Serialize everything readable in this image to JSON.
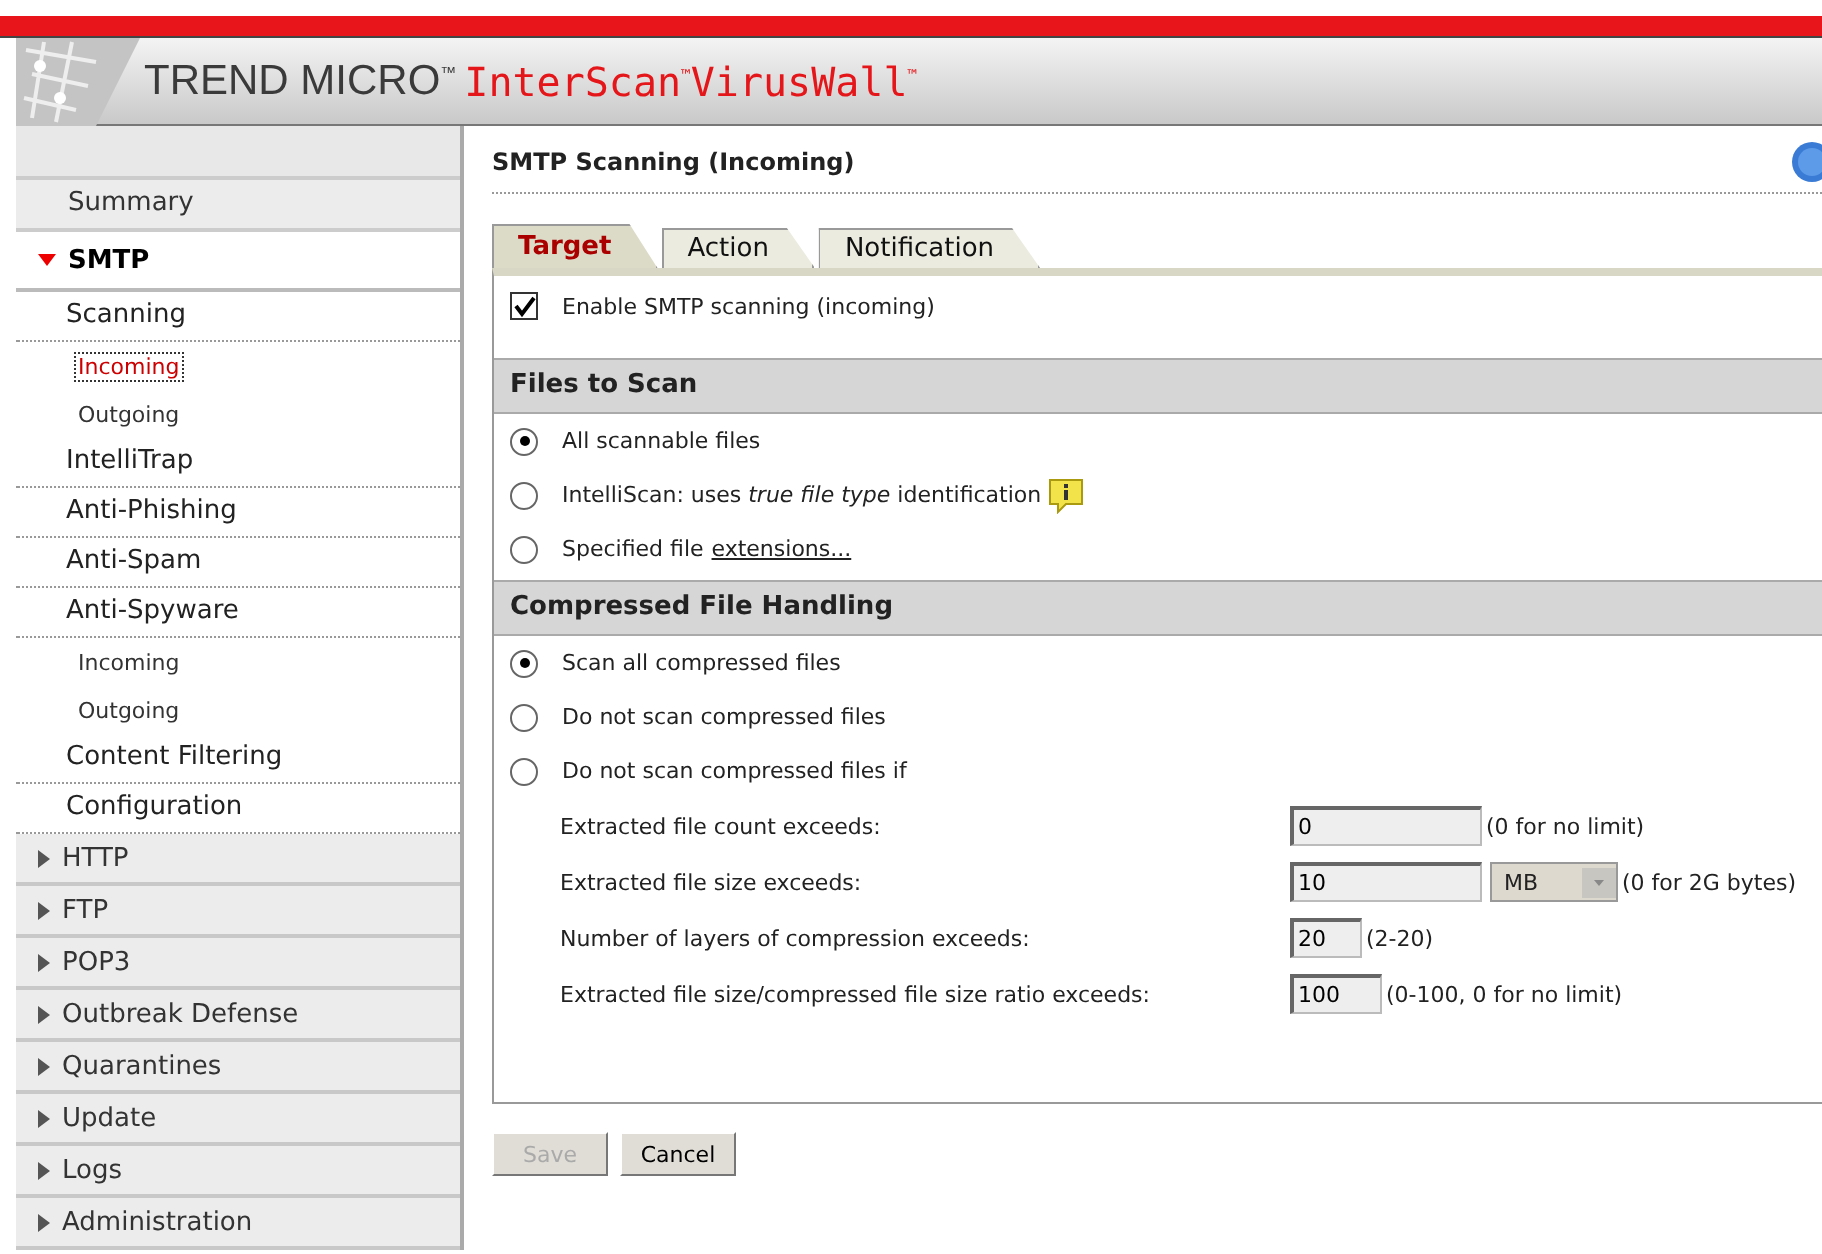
{
  "header": {
    "vendor": "TREND MICRO$^{™}$",
    "product": "InterScan$^{™}$VirusWall$^{™}$"
  },
  "sidebar": {
    "items": [
      {
        "label": "Summary",
        "kind": "top",
        "selected": false
      },
      {
        "label": "SMTP",
        "kind": "group",
        "expanded": true,
        "selected": false,
        "children": [
          {
            "label": "Scanning",
            "selected": false,
            "children": [
              {
                "label": "Incoming",
                "selected": true
              },
              {
                "label": "Outgoing",
                "selected": false
              }
            ]
          },
          {
            "label": "IntelliTrap",
            "selected": false
          },
          {
            "label": "Anti-Phishing",
            "selected": false
          },
          {
            "label": "Anti-Spam",
            "selected": false
          },
          {
            "label": "Anti-Spyware",
            "selected": false,
            "children": [
              {
                "label": "Incoming",
                "selected": false
              },
              {
                "label": "Outgoing",
                "selected": false
              }
            ]
          },
          {
            "label": "Content Filtering",
            "selected": false
          },
          {
            "label": "Configuration",
            "selected": false
          }
        ]
      },
      {
        "label": "HTTP",
        "kind": "group",
        "expanded": false,
        "selected": false
      },
      {
        "label": "FTP",
        "kind": "group",
        "expanded": false,
        "selected": false
      },
      {
        "label": "POP3",
        "kind": "group",
        "expanded": false,
        "selected": false
      },
      {
        "label": "Outbreak Defense",
        "kind": "group",
        "expanded": false,
        "selected": false
      },
      {
        "label": "Quarantines",
        "kind": "group",
        "expanded": false,
        "selected": false
      },
      {
        "label": "Update",
        "kind": "group",
        "expanded": false,
        "selected": false
      },
      {
        "label": "Logs",
        "kind": "group",
        "expanded": false,
        "selected": false
      },
      {
        "label": "Administration",
        "kind": "group",
        "expanded": false,
        "selected": false
      }
    ]
  },
  "page": {
    "title": "SMTP Scanning (Incoming)",
    "tabs": [
      {
        "label": "Target",
        "selected": true
      },
      {
        "label": "Action",
        "selected": false
      },
      {
        "label": "Notification",
        "selected": false
      }
    ],
    "enable": {
      "label": "Enable SMTP scanning (incoming)",
      "checked": true
    },
    "files_to_scan": {
      "heading": "Files to Scan",
      "options": [
        {
          "label": "All scannable files",
          "selected": true
        },
        {
          "label": "IntelliScan: uses *true file type* identification",
          "selected": false,
          "info": true
        },
        {
          "label": "Specified file ",
          "link": "extensions...",
          "selected": false
        }
      ]
    },
    "compressed": {
      "heading": "Compressed File Handling",
      "options": [
        {
          "label": "Scan all compressed files",
          "selected": true
        },
        {
          "label": "Do not scan compressed files",
          "selected": false
        },
        {
          "label": "Do not scan compressed files if",
          "selected": false
        }
      ],
      "limits": [
        {
          "label": "Extracted file count exceeds:",
          "value": "0",
          "hint": "(0 for no limit)",
          "disabled": true
        },
        {
          "label": "Extracted file size exceeds:",
          "value": "10",
          "unit": "MB",
          "hint": "(0 for 2G bytes)",
          "disabled": true
        },
        {
          "label": "Number of layers of compression exceeds:",
          "value": "20",
          "hint": "(2-20)",
          "disabled": true
        },
        {
          "label": "Extracted file size/compressed file size ratio exceeds:",
          "value": "100",
          "hint": "(0-100, 0 for no limit)",
          "disabled": true
        }
      ]
    },
    "buttons": [
      {
        "label": "Save",
        "disabled": true
      },
      {
        "label": "Cancel",
        "disabled": false
      }
    ]
  }
}
